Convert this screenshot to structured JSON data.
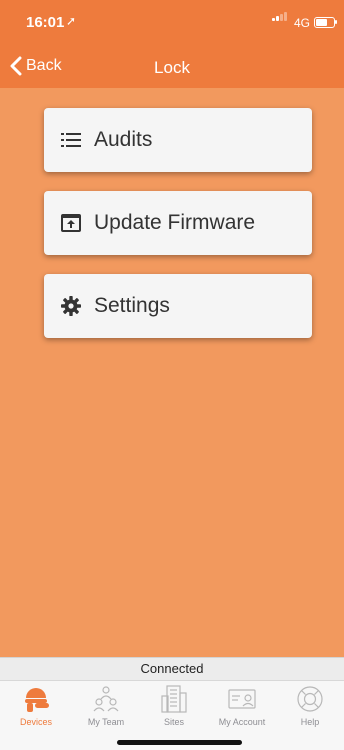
{
  "status": {
    "time": "16:01",
    "network": "4G"
  },
  "nav": {
    "back_label": "Back",
    "title": "Lock"
  },
  "menu": [
    {
      "label": "Audits",
      "icon": "list-icon"
    },
    {
      "label": "Update Firmware",
      "icon": "firmware-upload-icon"
    },
    {
      "label": "Settings",
      "icon": "gear-icon"
    }
  ],
  "connection_status": "Connected",
  "tabs": [
    {
      "label": "Devices",
      "icon": "lock-device-icon",
      "active": true
    },
    {
      "label": "My Team",
      "icon": "team-icon",
      "active": false
    },
    {
      "label": "Sites",
      "icon": "buildings-icon",
      "active": false
    },
    {
      "label": "My Account",
      "icon": "id-card-icon",
      "active": false
    },
    {
      "label": "Help",
      "icon": "lifebuoy-icon",
      "active": false
    }
  ],
  "colors": {
    "accent": "#EE7B3D",
    "background": "#F2995E",
    "card": "#F5F5F5",
    "tab_inactive": "#8E8E93"
  }
}
